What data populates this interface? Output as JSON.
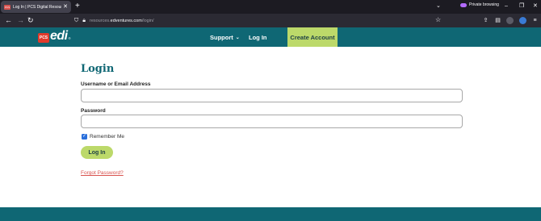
{
  "browser": {
    "tab_title": "Log In | PCS Digital Resources",
    "tab_close": "✕",
    "new_tab": "+",
    "tab_list": "⌄",
    "private_label": "Private browsing",
    "url_prefix": "resources.",
    "url_domain": "edventures.com",
    "url_path": "/login/",
    "icons": [
      "back-icon",
      "forward-icon",
      "reload-icon",
      "shield-icon",
      "lock-icon",
      "star-icon",
      "extensions-icon",
      "puzzle-icon",
      "account-icon",
      "menu-icon"
    ]
  },
  "header": {
    "logo_pcs": "PCS",
    "logo_edi": "edi",
    "logo_tm": "®",
    "support_label": "Support",
    "login_label": "Log In",
    "create_label": "Create Account"
  },
  "form": {
    "title": "Login",
    "username_label": "Username or Email Address",
    "username_value": "",
    "password_label": "Password",
    "password_value": "",
    "remember_label": "Remember Me",
    "remember_checked": true,
    "submit_label": "Log In",
    "forgot_label": "Forgot Password?"
  },
  "colors": {
    "teal": "#0f6774",
    "lime": "#bcd96a",
    "link_red": "#d9534f"
  }
}
